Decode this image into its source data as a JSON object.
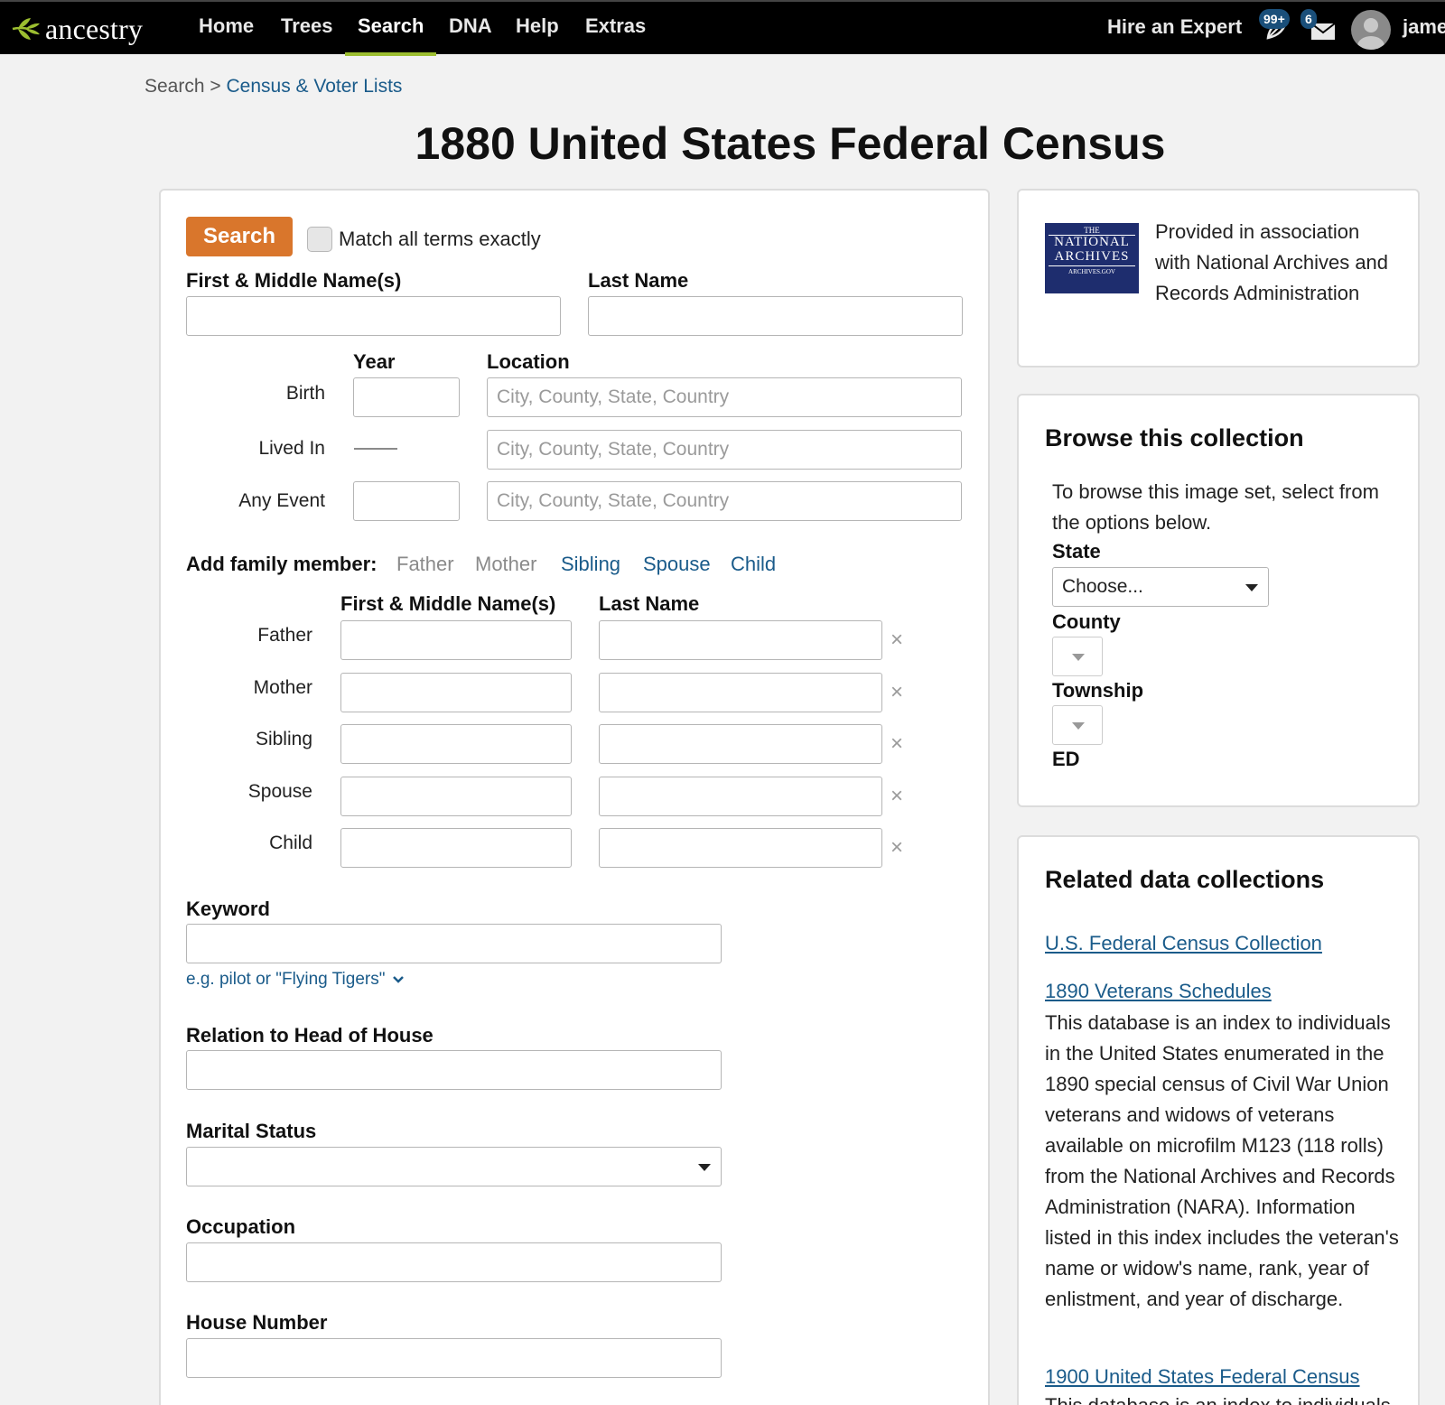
{
  "nav": {
    "logo_text": "ancestry",
    "items": [
      {
        "label": "Home",
        "active": false
      },
      {
        "label": "Trees",
        "active": false
      },
      {
        "label": "Search",
        "active": true
      },
      {
        "label": "DNA",
        "active": false
      },
      {
        "label": "Help",
        "active": false
      },
      {
        "label": "Extras",
        "active": false
      }
    ],
    "hire_expert": "Hire an Expert",
    "notifications_count": "99+",
    "messages_count": "6",
    "username": "jame",
    "accent": "#9cbe30"
  },
  "breadcrumb": {
    "root": "Search",
    "separator": ">",
    "current": "Census & Voter Lists"
  },
  "page_title": "1880 United States Federal Census",
  "search_form": {
    "search_button": "Search",
    "match_exact_label": "Match all terms exactly",
    "match_exact_checked": false,
    "first_middle_label": "First & Middle Name(s)",
    "last_name_label": "Last Name",
    "year_header": "Year",
    "location_header": "Location",
    "events": [
      {
        "label": "Birth",
        "location_placeholder": "City, County, State, Country"
      },
      {
        "label": "Lived In",
        "location_placeholder": "City, County, State, Country"
      },
      {
        "label": "Any Event",
        "location_placeholder": "City, County, State, Country"
      }
    ],
    "add_family_label": "Add family member:",
    "family_links": [
      "Father",
      "Mother",
      "Sibling",
      "Spouse",
      "Child"
    ],
    "family_first_header": "First & Middle Name(s)",
    "family_last_header": "Last Name",
    "family_rows": [
      "Father",
      "Mother",
      "Sibling",
      "Spouse",
      "Child"
    ],
    "keyword_label": "Keyword",
    "keyword_hint": "e.g. pilot or \"Flying Tigers\"",
    "relation_label": "Relation to Head of House",
    "marital_label": "Marital Status",
    "occupation_label": "Occupation",
    "house_number_label": "House Number",
    "button_color": "#d9762c"
  },
  "nara": {
    "logo_line1": "THE",
    "logo_line2": "NATIONAL",
    "logo_line3": "ARCHIVES",
    "logo_line4": "ARCHIVES.GOV",
    "text": "Provided in association with National Archives and Records Administration"
  },
  "browse": {
    "heading": "Browse this collection",
    "intro": "To browse this image set, select from the options below.",
    "state_label": "State",
    "state_value": "Choose...",
    "county_label": "County",
    "township_label": "Township",
    "ed_label": "ED"
  },
  "related": {
    "heading": "Related data collections",
    "items": [
      {
        "title": "U.S. Federal Census Collection",
        "desc": ""
      },
      {
        "title": "1890 Veterans Schedules",
        "desc": "This database is an index to individuals in the United States enumerated in the 1890 special census of Civil War Union veterans and widows of veterans available on microfilm M123 (118 rolls) from the National Archives and Records Administration (NARA). Information listed in this index includes the veteran's name or widow's name, rank, year of enlistment, and year of discharge."
      },
      {
        "title": "1900 United States Federal Census",
        "desc": "This database is an index to individuals"
      }
    ]
  }
}
